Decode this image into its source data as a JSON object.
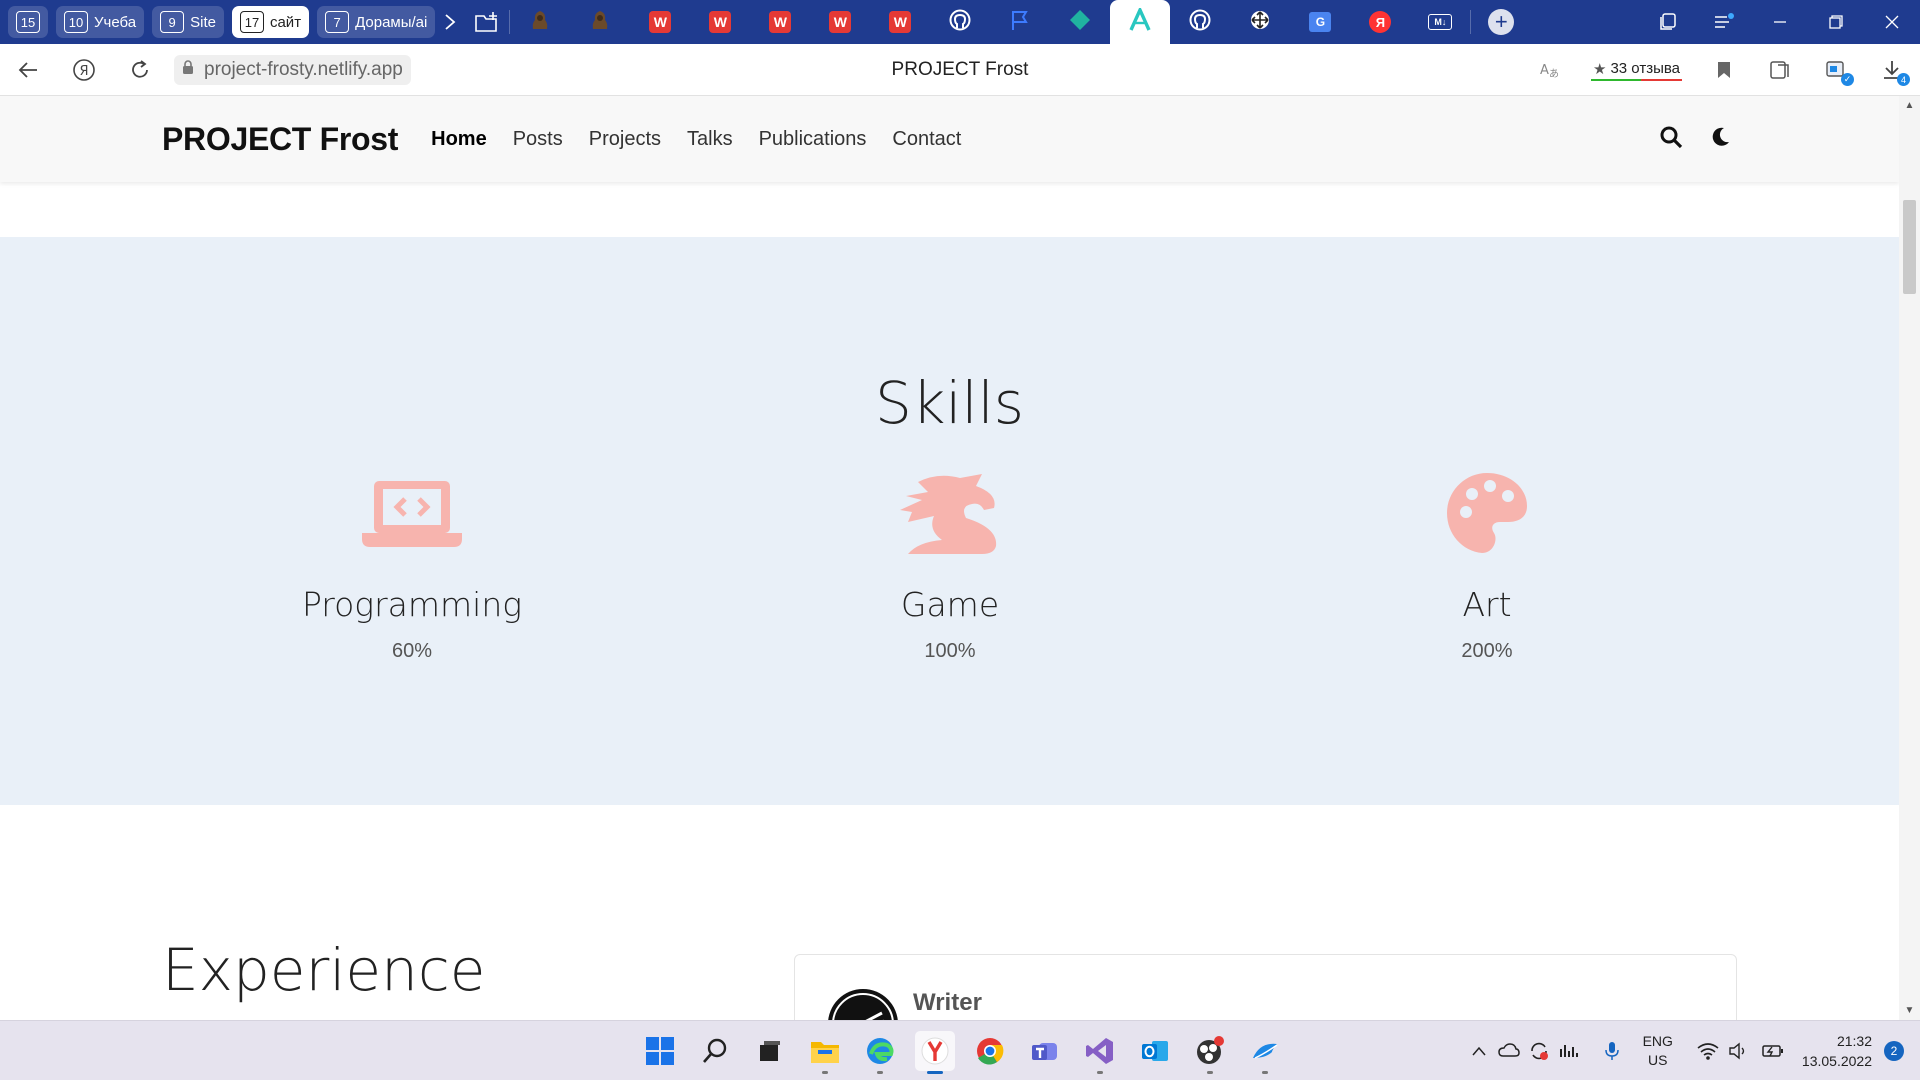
{
  "browser": {
    "tab_groups": [
      {
        "count": "15",
        "label": ""
      },
      {
        "count": "10",
        "label": "Учеба"
      },
      {
        "count": "9",
        "label": "Site"
      },
      {
        "count": "17",
        "label": "сайт"
      },
      {
        "count": "7",
        "label": "Дорамы/аі"
      }
    ],
    "active_group_index": 3,
    "favicon_tabs": [
      {
        "icon": "avatar-icon",
        "color": "#6b4a2a"
      },
      {
        "icon": "avatar-icon",
        "color": "#6b4a2a"
      },
      {
        "icon": "w-icon",
        "color": "#e53935"
      },
      {
        "icon": "w-icon",
        "color": "#e53935"
      },
      {
        "icon": "w-icon",
        "color": "#e53935"
      },
      {
        "icon": "w-icon",
        "color": "#e53935"
      },
      {
        "icon": "w-icon",
        "color": "#e53935"
      },
      {
        "icon": "github-icon",
        "color": "#ffffff"
      },
      {
        "icon": "flag-icon",
        "color": "#3d7bff"
      },
      {
        "icon": "diamond-icon",
        "color": "#20b2a0"
      },
      {
        "icon": "a-logo-icon",
        "color": "#29c7c0"
      },
      {
        "icon": "github-icon",
        "color": "#ffffff"
      },
      {
        "icon": "move-icon",
        "color": "#ffffff"
      }
    ],
    "active_tab_index": 10,
    "url": "project-frosty.netlify.app",
    "page_title": "PROJECT Frost",
    "reviews_label": "33 отзыва",
    "downloads_badge": "4"
  },
  "site": {
    "brand": "PROJECT Frost",
    "nav": [
      "Home",
      "Posts",
      "Projects",
      "Talks",
      "Publications",
      "Contact"
    ],
    "active_nav_index": 0,
    "skills": {
      "title": "Skills",
      "accent_color": "#f7b4ae",
      "items": [
        {
          "name": "Programming",
          "percent": "60%",
          "icon": "laptop-code-icon"
        },
        {
          "name": "Game",
          "percent": "100%",
          "icon": "dragon-icon"
        },
        {
          "name": "Art",
          "percent": "200%",
          "icon": "palette-icon"
        }
      ]
    },
    "experience": {
      "title": "Experience",
      "first_role": "Writer"
    }
  },
  "taskbar": {
    "language": "ENG",
    "region": "US",
    "time": "21:32",
    "date": "13.05.2022",
    "notifications": "2"
  }
}
